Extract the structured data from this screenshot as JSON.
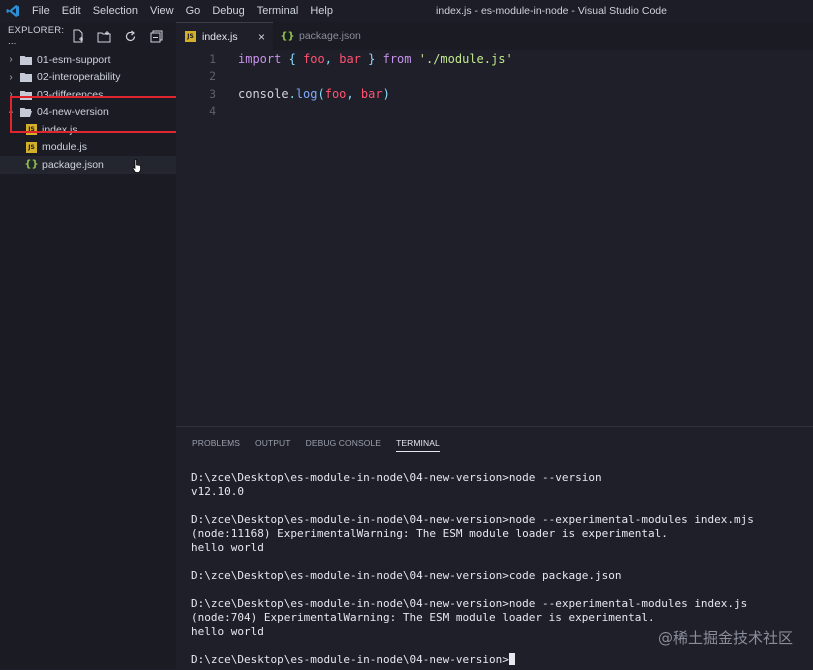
{
  "titlebar": {
    "menu": [
      "File",
      "Edit",
      "Selection",
      "View",
      "Go",
      "Debug",
      "Terminal",
      "Help"
    ],
    "window_title": "index.js - es-module-in-node - Visual Studio Code"
  },
  "sidebar": {
    "title": "EXPLORER: ...",
    "folders": [
      {
        "label": "01-esm-support"
      },
      {
        "label": "02-interoperability"
      },
      {
        "label": "03-differences"
      },
      {
        "label": "04-new-version"
      }
    ],
    "files": [
      {
        "label": "index.js",
        "icon": "JS"
      },
      {
        "label": "module.js",
        "icon": "JS"
      },
      {
        "label": "package.json",
        "icon": "{}"
      }
    ]
  },
  "tabs": [
    {
      "label": "index.js",
      "icon": "JS",
      "close": "×"
    },
    {
      "label": "package.json",
      "icon": "{}"
    }
  ],
  "editor": {
    "line_numbers": [
      "1",
      "2",
      "3",
      "4"
    ],
    "line1": {
      "t1": "import",
      "t2": "{",
      "t3": "foo",
      "t4": ",",
      "t5": "bar",
      "t6": "}",
      "t7": "from",
      "t8": "'./module.js'"
    },
    "line3": {
      "t1": "console",
      "t2": ".",
      "t3": "log",
      "t4": "(",
      "t5": "foo",
      "t6": ",",
      "t7": "bar",
      "t8": ")"
    }
  },
  "panel": {
    "tabs": [
      "PROBLEMS",
      "OUTPUT",
      "DEBUG CONSOLE",
      "TERMINAL"
    ],
    "terminal_lines": [
      "D:\\zce\\Desktop\\es-module-in-node\\04-new-version>node --version",
      "v12.10.0",
      "",
      "D:\\zce\\Desktop\\es-module-in-node\\04-new-version>node --experimental-modules index.mjs",
      "(node:11168) ExperimentalWarning: The ESM module loader is experimental.",
      "hello world",
      "",
      "D:\\zce\\Desktop\\es-module-in-node\\04-new-version>code package.json",
      "",
      "D:\\zce\\Desktop\\es-module-in-node\\04-new-version>node --experimental-modules index.js",
      "(node:704) ExperimentalWarning: The ESM module loader is experimental.",
      "hello world",
      "",
      "D:\\zce\\Desktop\\es-module-in-node\\04-new-version>"
    ]
  },
  "watermark": "@稀土掘金技术社区",
  "colors": {
    "accent": "#e0252f",
    "js_icon": "#d4b02a",
    "vscode_blue": "#2d8fd6"
  }
}
